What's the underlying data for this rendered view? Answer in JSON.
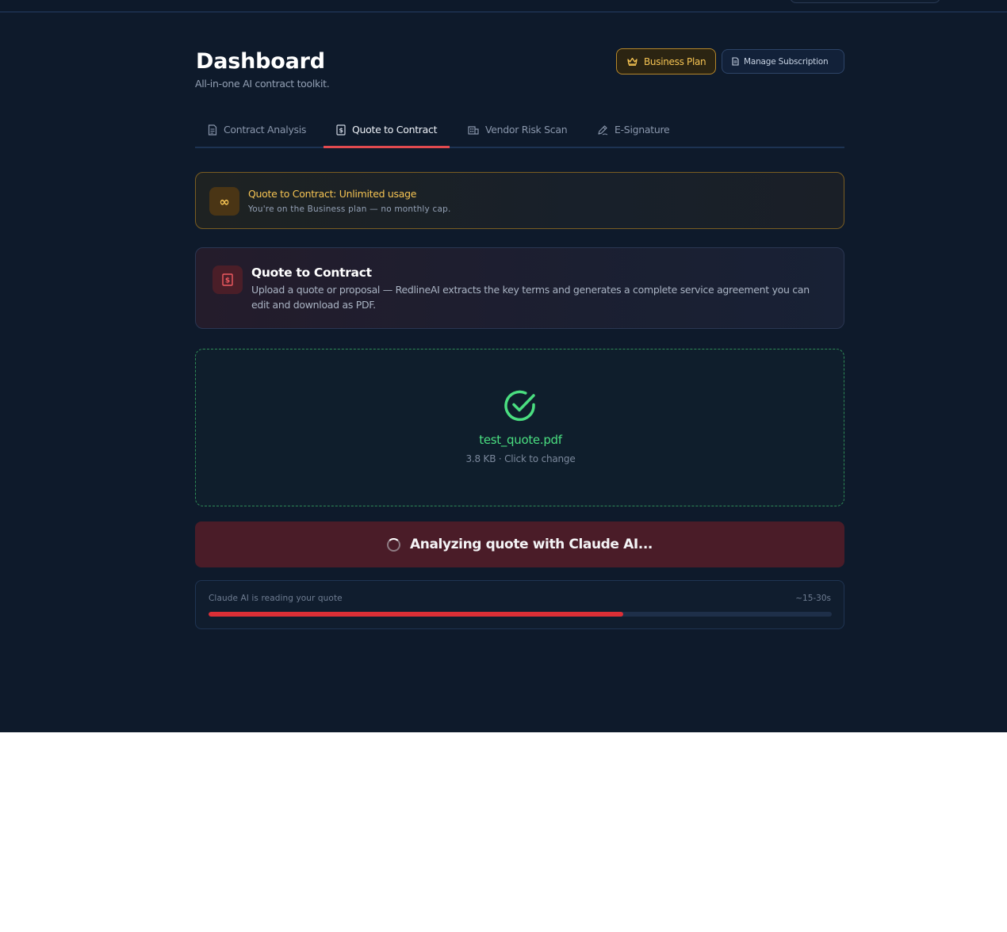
{
  "header": {
    "title": "Dashboard",
    "subtitle": "All-in-one AI contract toolkit.",
    "plan_button": "Business Plan",
    "manage_button": "Manage Subscription"
  },
  "tabs": [
    {
      "label": "Contract Analysis",
      "icon": "document-icon"
    },
    {
      "label": "Quote to Contract",
      "icon": "dollar-doc-icon",
      "active": true
    },
    {
      "label": "Vendor Risk Scan",
      "icon": "building-icon"
    },
    {
      "label": "E-Signature",
      "icon": "pen-icon"
    }
  ],
  "usage": {
    "icon": "∞",
    "title": "Quote to Contract: Unlimited usage",
    "subtitle": "You're on the Business plan — no monthly cap."
  },
  "feature": {
    "title": "Quote to Contract",
    "description": "Upload a quote or proposal — RedlineAI extracts the key terms and generates a complete service agreement you can edit and download as PDF."
  },
  "upload": {
    "file_name": "test_quote.pdf",
    "meta": "3.8 KB · Click to change"
  },
  "analyze_button": "Analyzing quote with Claude AI...",
  "progress": {
    "label": "Claude AI is reading your quote",
    "eta": "~15-30s",
    "percent": 66.5
  },
  "colors": {
    "background": "#0e1a2b",
    "accent_red": "#dc2f36",
    "gold": "#f6c453",
    "success_green": "#4ade80"
  }
}
